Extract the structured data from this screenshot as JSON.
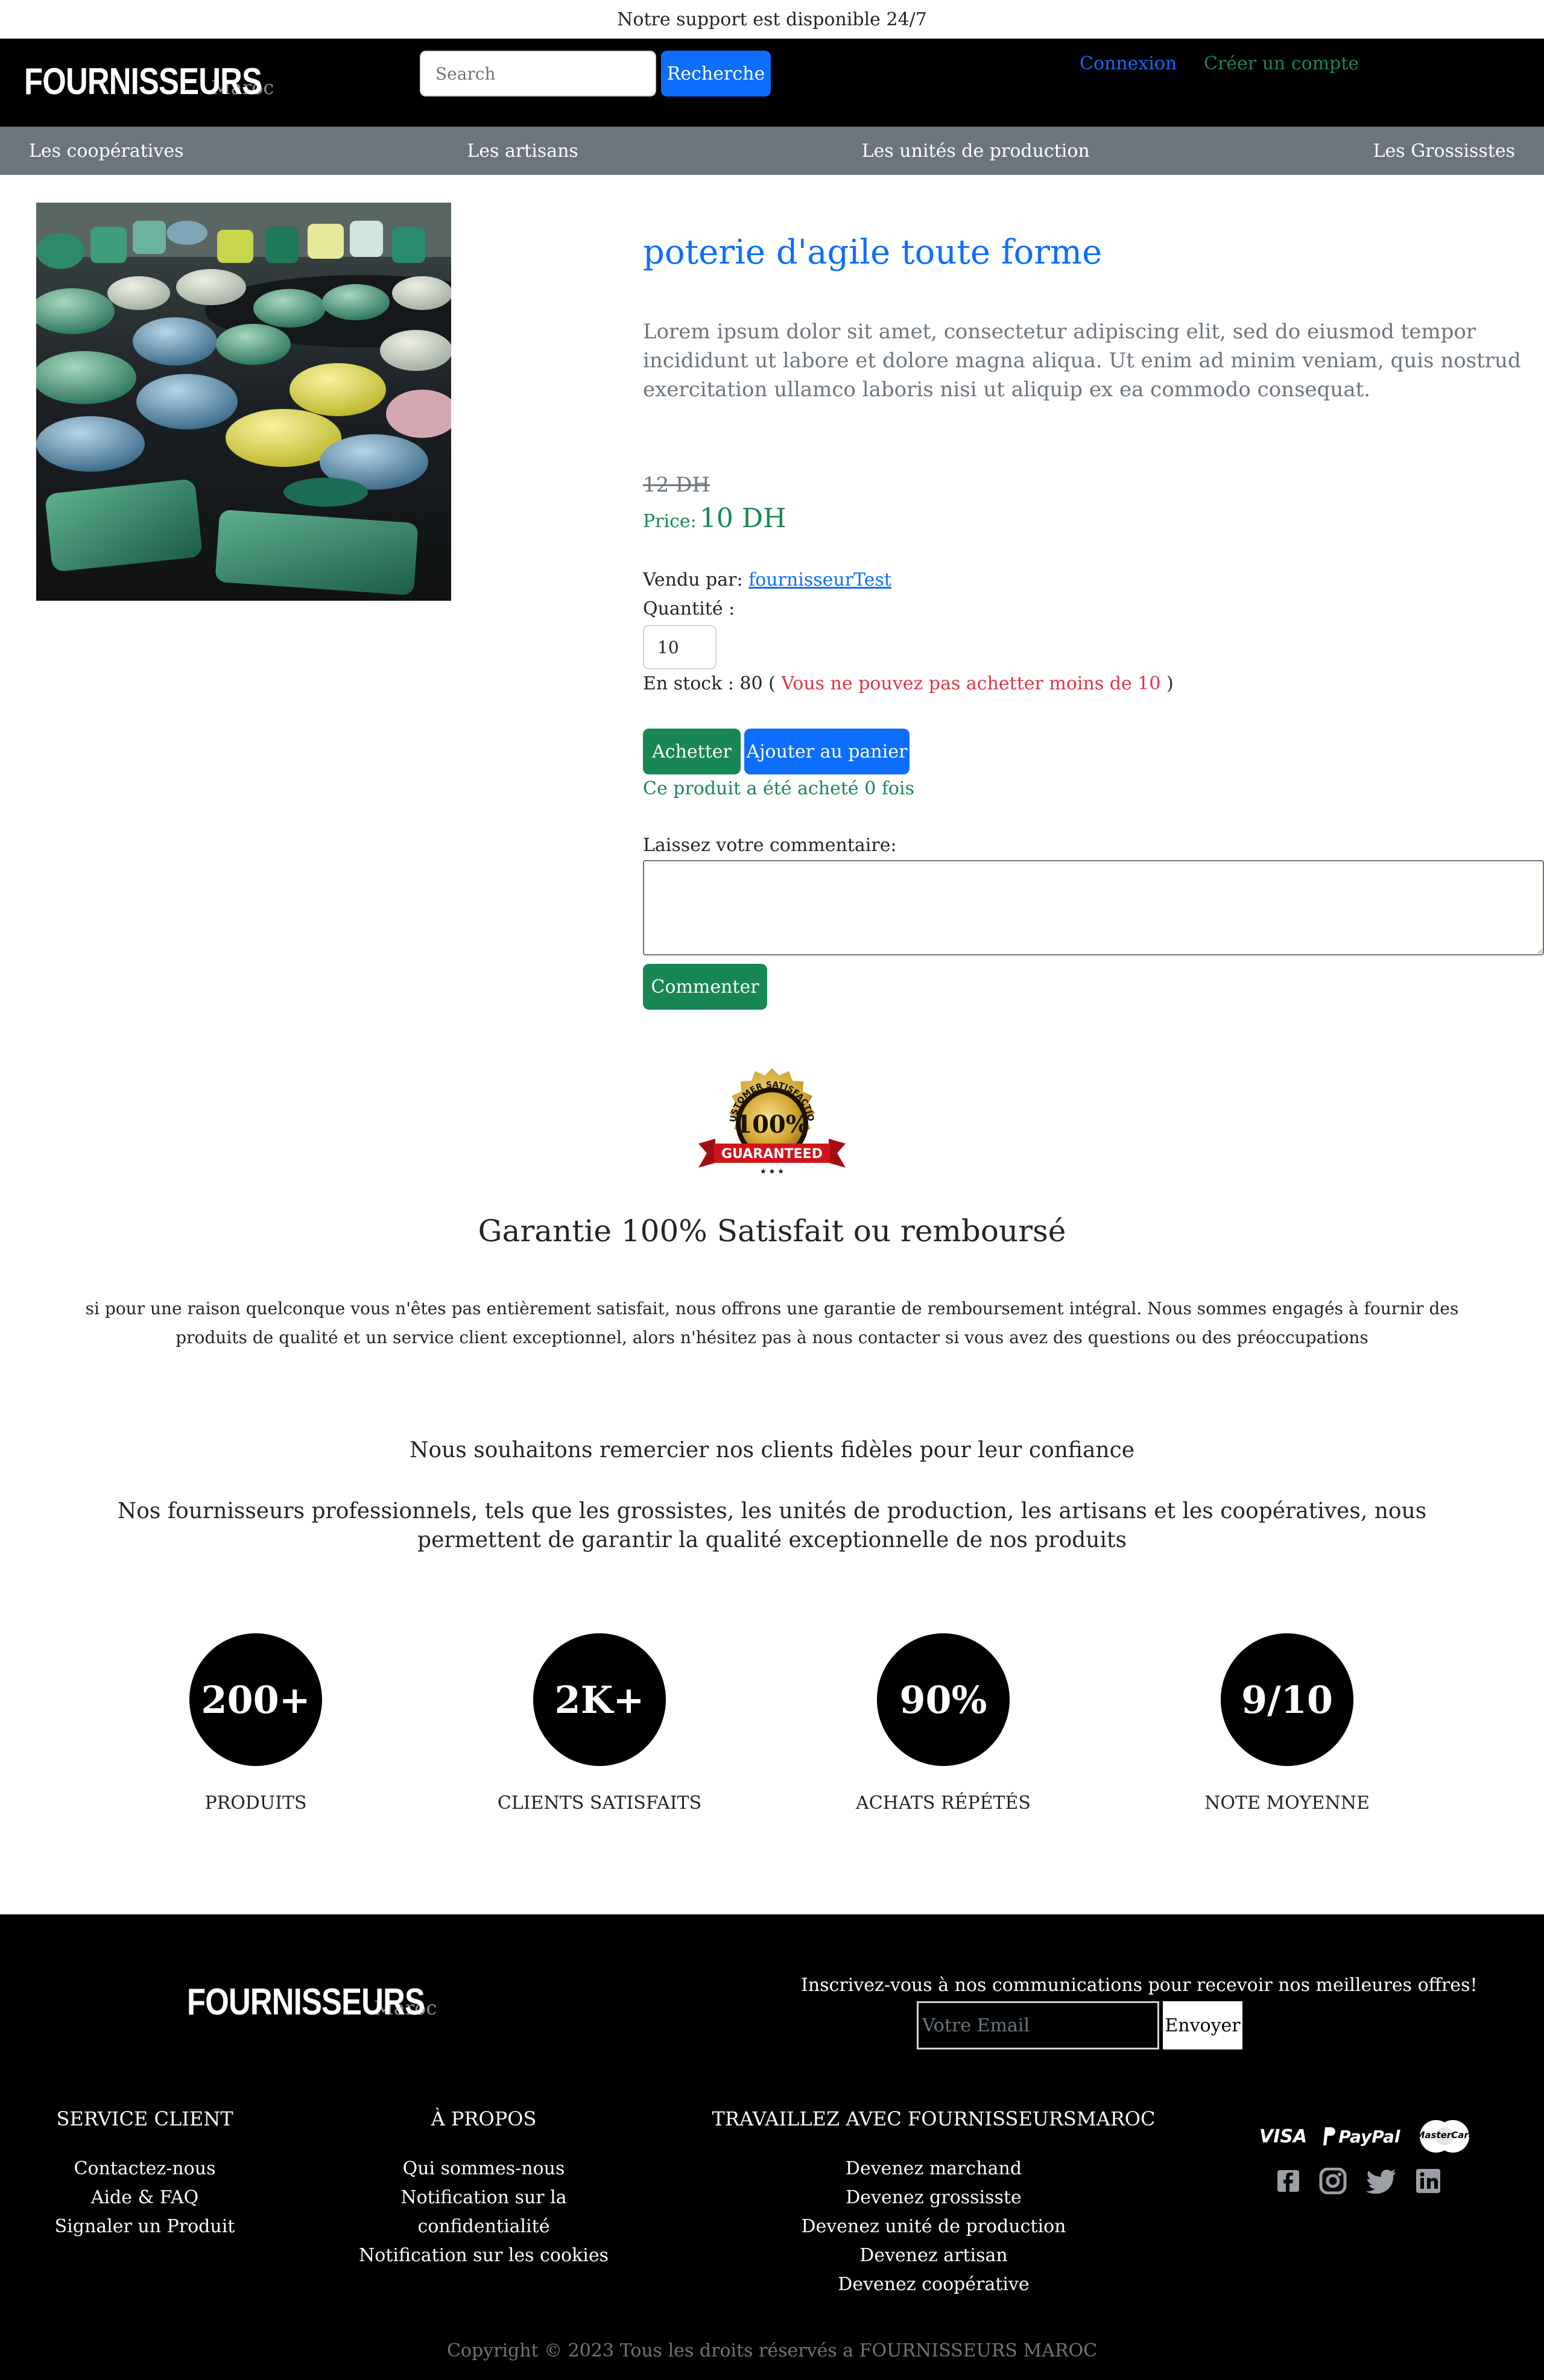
{
  "topbar": {
    "text": "Notre support est disponible 24/7"
  },
  "header": {
    "logo_main": "FOURNISSEURS",
    "logo_sub": "Maroc",
    "search_placeholder": "Search",
    "search_button": "Recherche",
    "login": "Connexion",
    "signup": "Créer un compte"
  },
  "nav": {
    "items": [
      "Les coopératives",
      "Les artisans",
      "Les unités de production",
      "Les Grossisstes"
    ]
  },
  "product": {
    "title": "poterie d'agile toute forme",
    "description": "Lorem ipsum dolor sit amet, consectetur adipiscing elit, sed do eiusmod tempor incididunt ut labore et dolore magna aliqua. Ut enim ad minim veniam, quis nostrud exercitation ullamco laboris nisi ut aliquip ex ea commodo consequat.",
    "old_price": "12 DH",
    "price_label": "Price:",
    "price": "10 DH",
    "sold_by_label": "Vendu par:",
    "seller": "fournisseurTest",
    "quantity_label": "Quantité :",
    "quantity_value": "10",
    "stock_label": "En stock : 80 (",
    "stock_warning": "Vous ne pouvez pas achetter moins de 10",
    "stock_close": ")",
    "buy_button": "Achetter",
    "cart_button": "Ajouter au panier",
    "bought_text": "Ce produit a été acheté 0 fois",
    "comment_label": "Laissez votre commentaire:",
    "comment_button": "Commenter"
  },
  "guarantee": {
    "badge_top": "CUSTOMER SATISFACTION",
    "badge_mid": "100%",
    "badge_banner": "GUARANTEED",
    "title": "Garantie 100% Satisfait ou remboursé",
    "text": "si pour une raison quelconque vous n'êtes pas entièrement satisfait, nous offrons une garantie de remboursement intégral. Nous sommes engagés à fournir des produits de qualité et un service client exceptionnel, alors n'hésitez pas à nous contacter si vous avez des questions ou des préoccupations"
  },
  "thanks": {
    "line1": "Nous souhaitons remercier nos clients fidèles pour leur confiance",
    "line2": "Nos fournisseurs professionnels, tels que les grossistes, les unités de production, les artisans et les coopératives, nous permettent de garantir la qualité exceptionnelle de nos produits"
  },
  "stats": [
    {
      "value": "200+",
      "label": "PRODUITS"
    },
    {
      "value": "2K+",
      "label": "CLIENTS SATISFAITS"
    },
    {
      "value": "90%",
      "label": "ACHATS RÉPÉTÉS"
    },
    {
      "value": "9/10",
      "label": "NOTE MOYENNE"
    }
  ],
  "footer": {
    "logo_main": "FOURNISSEURS",
    "logo_sub": "Maroc",
    "newsletter": "Inscrivez-vous à nos communications pour recevoir nos meilleures offres!",
    "email_placeholder": "Votre Email",
    "send_button": "Envoyer",
    "columns": [
      {
        "title": "SERVICE CLIENT",
        "links": [
          "Contactez-nous",
          "Aide & FAQ",
          "Signaler un Produit"
        ]
      },
      {
        "title": "À PROPOS",
        "links": [
          "Qui sommes-nous",
          "Notification sur la confidentialité",
          "Notification sur les cookies"
        ]
      },
      {
        "title": "TRAVAILLEZ AVEC FOURNISSEURSMAROC",
        "links": [
          "Devenez marchand",
          "Devenez grossisste",
          "Devenez unité de production",
          "Devenez artisan",
          "Devenez coopérative"
        ]
      }
    ],
    "payments": {
      "visa": "VISA",
      "paypal": "PayPal",
      "mastercard": "MasterCard"
    },
    "social_icons": [
      "facebook-icon",
      "instagram-icon",
      "twitter-icon",
      "linkedin-icon"
    ],
    "copyright": "Copyright © 2023 Tous les droits réservés a FOURNISSEURS MAROC"
  },
  "colors": {
    "primary": "#0d6efd",
    "success": "#198754",
    "danger": "#dc3545",
    "secondary": "#6c757d",
    "dark": "#000000"
  }
}
